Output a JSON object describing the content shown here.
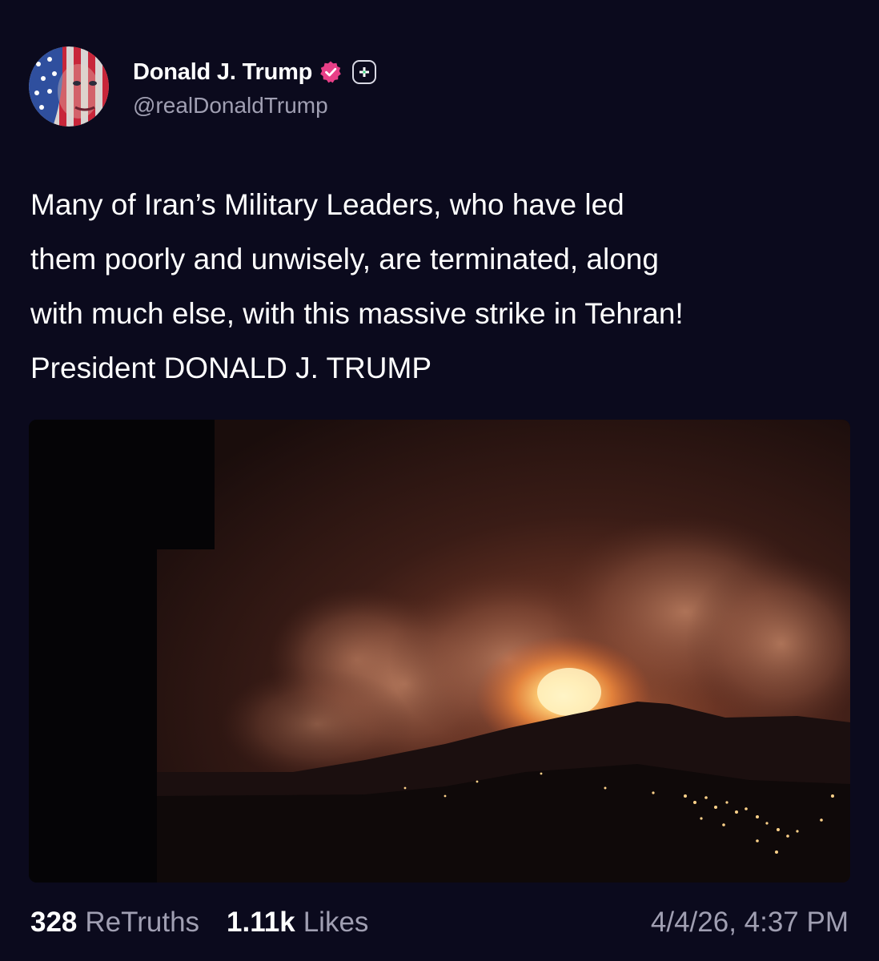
{
  "author": {
    "display_name": "Donald J. Trump",
    "handle": "@realDonaldTrump",
    "verified_color": "#e83f87",
    "icons": [
      "verified-badge-icon",
      "plus-icon"
    ]
  },
  "post": {
    "lines": [
      "Many of Iran’s Military Leaders, who have led",
      "them poorly and unwisely, are terminated, along",
      "with much else, with this massive strike in Tehran!",
      "President DONALD J. TRUMP"
    ]
  },
  "stats": {
    "retruths_count": "328",
    "retruths_label": "ReTruths",
    "likes_count": "1.11k",
    "likes_label": "Likes"
  },
  "timestamp": "4/4/26, 4:37 PM",
  "colors": {
    "background": "#0b0a1d",
    "secondary_text": "#a09fb2",
    "primary_text": "#ffffff"
  }
}
